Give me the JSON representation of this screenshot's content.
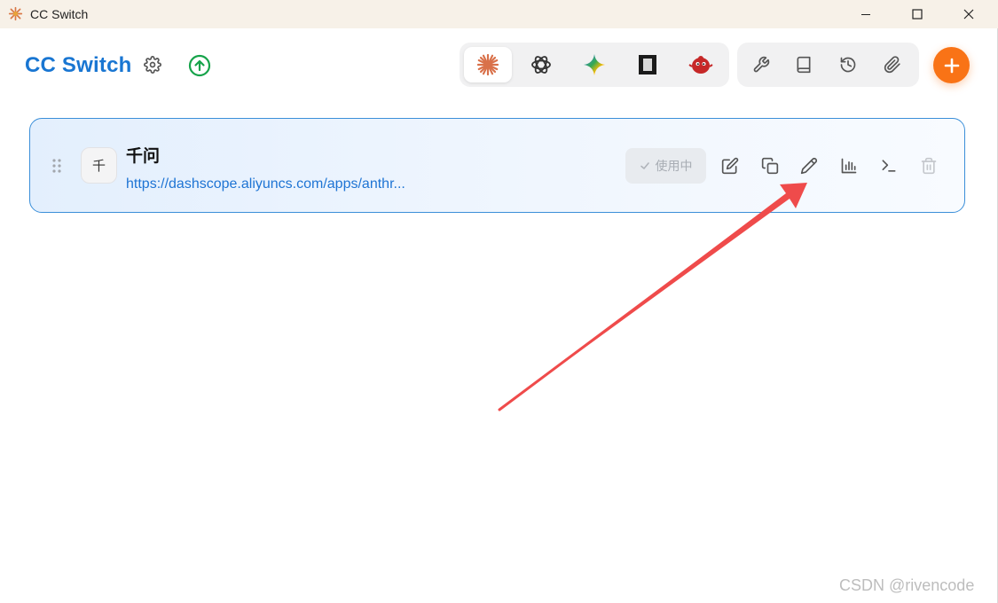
{
  "window": {
    "title": "CC Switch",
    "controls": [
      "minimize-icon",
      "maximize-icon",
      "close-icon"
    ]
  },
  "header": {
    "brand": "CC Switch",
    "settings_icon": "gear-icon",
    "update_icon": "arrow-up-circle-icon",
    "app_tabs": [
      {
        "name": "claude",
        "icon": "claude-starburst-icon",
        "active": true
      },
      {
        "name": "codex",
        "icon": "openai-icon",
        "active": false
      },
      {
        "name": "gemini",
        "icon": "gemini-sparkle-icon",
        "active": false
      },
      {
        "name": "terminal-app",
        "icon": "dark-square-icon",
        "active": false
      },
      {
        "name": "mascot-app",
        "icon": "red-bird-icon",
        "active": false
      }
    ],
    "tool_tabs": [
      {
        "name": "tools",
        "icon": "wrench-icon"
      },
      {
        "name": "docs",
        "icon": "book-icon"
      },
      {
        "name": "history",
        "icon": "history-icon"
      },
      {
        "name": "attachments",
        "icon": "paperclip-icon"
      }
    ],
    "add_icon": "plus-icon"
  },
  "provider": {
    "avatar_char": "千",
    "name": "千问",
    "url": "https://dashscope.aliyuncs.com/apps/anthr...",
    "status_label": "使用中",
    "actions": [
      "edit-icon",
      "copy-icon",
      "pencil-icon",
      "bar-chart-icon",
      "terminal-icon",
      "trash-icon"
    ]
  },
  "watermark": "CSDN @rivencode",
  "colors": {
    "brand": "#1976d2",
    "accent": "#f97316",
    "card_border": "#3b8fd9",
    "url": "#1e74d4",
    "update": "#16a34a",
    "annotation_arrow": "#ef4b4b"
  }
}
